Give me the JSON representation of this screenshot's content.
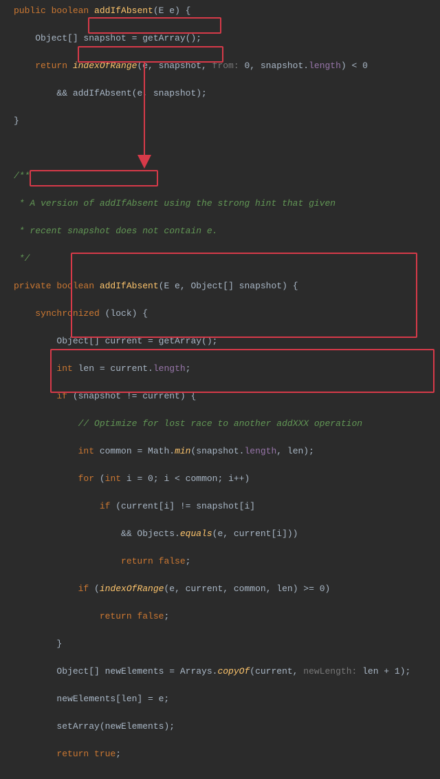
{
  "code": {
    "l1_public": "public",
    "l1_boolean": "boolean",
    "l1_method": "addIfAbsent",
    "l1_rest": "(E e) {",
    "l2_pre": "    Object[] ",
    "l2_snap": "snapshot = getArray();",
    "l3_return": "    return",
    "l3_method": " indexOfRange",
    "l3_args": "(e, snapshot, ",
    "l3_hint": "from:",
    "l3_rest": " 0, snapshot.",
    "l3_length": "length",
    "l3_end": ") < 0",
    "l4_and": "        && ",
    "l4_call": "addIfAbsent(e, snapshot);",
    "l5": "}",
    "l6": "",
    "l7": "/**",
    "l8": " * A version of addIfAbsent using the strong hint that given",
    "l9": " * recent snapshot does not contain e.",
    "l10": " */",
    "l11_private": "private",
    "l11_boolean": " boolean",
    "l11_method": " addIfAbsent",
    "l11_rest": "(E e, Object[] snapshot) {",
    "l12_pre": "    ",
    "l12_sync": "synchronized",
    "l12_rest": " (lock) {",
    "l13_pre": "        Object[] current = ",
    "l13_call": "getArray",
    "l13_end": "();",
    "l14_pre": "        ",
    "l14_int": "int",
    "l14_rest": " len = current.",
    "l14_length": "length",
    "l14_semi": ";",
    "l15_pre": "        ",
    "l15_if": "if",
    "l15_rest": " (snapshot != current) {",
    "l16": "            // Optimize for lost race to another addXXX operation",
    "l17_pre": "            ",
    "l17_int": "int",
    "l17_rest": " common = Math.",
    "l17_min": "min",
    "l17_args": "(snapshot.",
    "l17_length": "length",
    "l17_end": ", len);",
    "l18_pre": "            ",
    "l18_for": "for",
    "l18_rest": " (",
    "l18_int": "int",
    "l18_rest2": " i = 0; i < common; i++)",
    "l19_pre": "                ",
    "l19_if": "if",
    "l19_rest": " (current[i] != snapshot[i]",
    "l20_pre": "                    && Objects.",
    "l20_equals": "equals",
    "l20_rest": "(e, current[i]))",
    "l21_pre": "                    ",
    "l21_return": "return",
    "l21_rest": " ",
    "l21_false": "false",
    "l21_semi": ";",
    "l22_pre": "            ",
    "l22_if": "if",
    "l22_rest": " (",
    "l22_method": "indexOfRange",
    "l22_args": "(e, current, common, len) >= 0)",
    "l23_pre": "                ",
    "l23_return": "return",
    "l23_rest": " ",
    "l23_false": "false",
    "l23_semi": ";",
    "l24": "        }",
    "l25_pre": "        Object[] newElements = Arrays.",
    "l25_copyof": "copyOf",
    "l25_args": "(current, ",
    "l25_hint": "newLength:",
    "l25_rest": " len + 1);",
    "l26": "        newElements[len] = e;",
    "l27_pre": "        ",
    "l27_call": "setArray",
    "l27_rest": "(newElements);",
    "l28_pre": "        ",
    "l28_return": "return",
    "l28_rest": " ",
    "l28_true": "true",
    "l28_semi": ";"
  }
}
